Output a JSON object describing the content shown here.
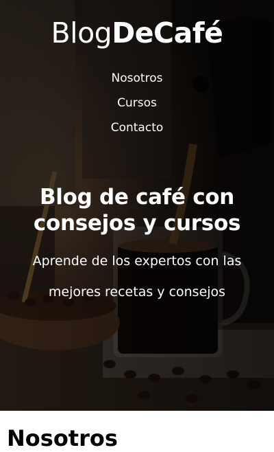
{
  "header": {
    "logo_regular": "Blog",
    "logo_bold": "DeCafé"
  },
  "nav": {
    "items": [
      "Nosotros",
      "Cursos",
      "Contacto"
    ]
  },
  "hero": {
    "title": "Blog de café con consejos y cursos",
    "subtitle": "Aprende de los expertos con las mejores recetas y consejos"
  },
  "section": {
    "heading": "Nosotros"
  }
}
